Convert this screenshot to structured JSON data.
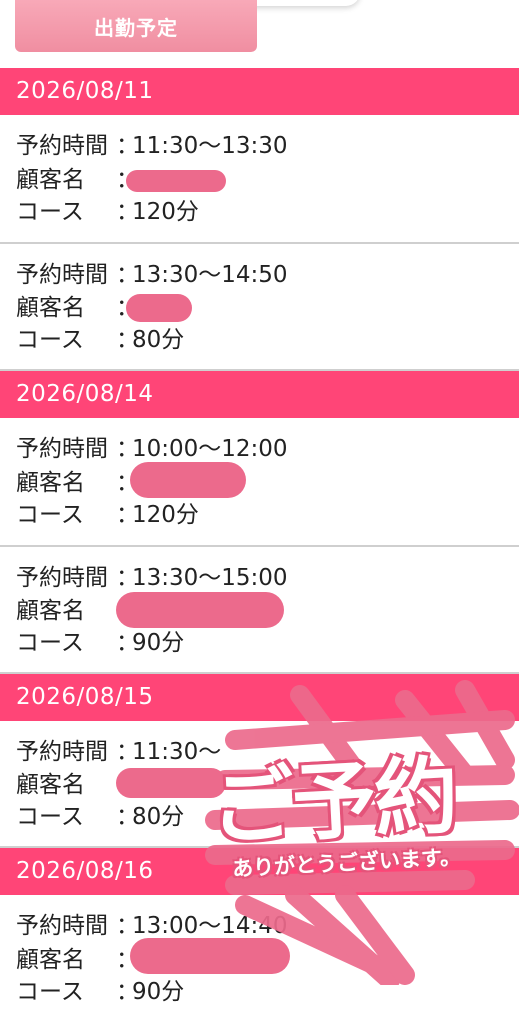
{
  "header": {
    "shift_button_label": "出勤予定"
  },
  "labels": {
    "time": "予約時間",
    "customer": "顧客名",
    "course": "コース",
    "colon": "："
  },
  "dates": [
    {
      "date": "2026/08/11",
      "reservations": [
        {
          "time": "11:30～13:30",
          "course": "120分"
        },
        {
          "time": "13:30～14:50",
          "course": "80分"
        }
      ]
    },
    {
      "date": "2026/08/14",
      "reservations": [
        {
          "time": "10:00～12:00",
          "course": "120分"
        },
        {
          "time": "13:30～15:00",
          "course": "90分"
        }
      ]
    },
    {
      "date": "2026/08/15",
      "reservations": [
        {
          "time": "11:30～",
          "course": "80分"
        }
      ]
    },
    {
      "date": "2026/08/16",
      "reservations": [
        {
          "time": "13:00～14:40",
          "course": "90分"
        }
      ]
    }
  ],
  "sticker": {
    "main": "ご予約",
    "sub": "ありがとうございます。",
    "color": "#ec6a8c"
  },
  "colors": {
    "date_header": "#ff4577",
    "shift_button": "#f08ea1"
  }
}
